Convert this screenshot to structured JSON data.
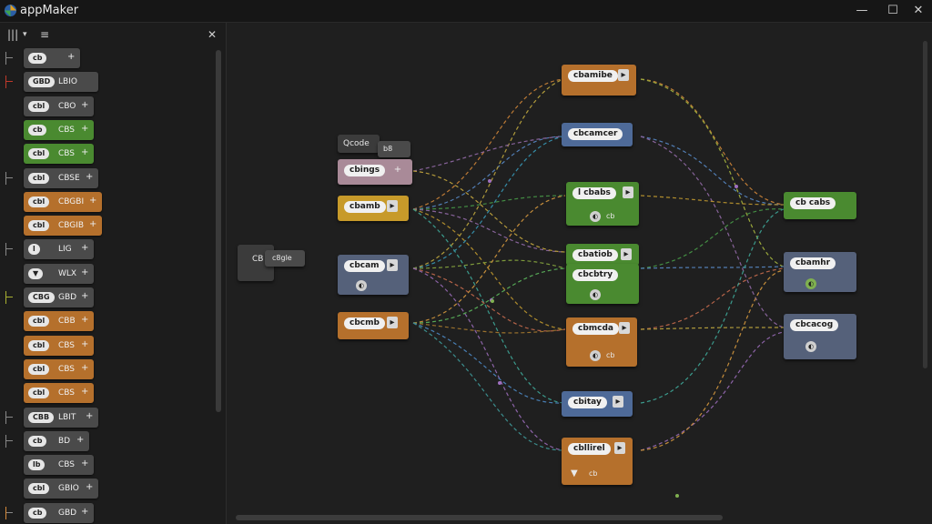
{
  "app": {
    "title": "appMaker"
  },
  "window": {
    "minimize": "—",
    "maximize": "☐",
    "close": "✕"
  },
  "toolbar": {
    "columns_icon": "|||",
    "dropdown": "▾",
    "menu_icon": "≡",
    "close_icon": "✕"
  },
  "palette": [
    {
      "chip": "cb",
      "text": "",
      "plus": "+",
      "color": "#4a4a4a",
      "bracket": "gray"
    },
    {
      "chip": "GBD",
      "text": "LBIO",
      "plus": "",
      "color": "#4a4a4a",
      "bracket": "red"
    },
    {
      "chip": "cbl",
      "text": "CBO",
      "plus": "+",
      "color": "#4a4a4a",
      "bracket": "none"
    },
    {
      "chip": "cb",
      "text": "CBS",
      "plus": "+",
      "color": "#4a8a30",
      "bracket": "none"
    },
    {
      "chip": "cbl",
      "text": "CBS",
      "plus": "+",
      "color": "#4a8a30",
      "bracket": "none"
    },
    {
      "chip": "cbl",
      "text": "CBSE",
      "plus": "+",
      "color": "#4a4a4a",
      "bracket": "gray"
    },
    {
      "chip": "cbl",
      "text": "CBGBI",
      "plus": "+",
      "color": "#b5702c",
      "bracket": "none"
    },
    {
      "chip": "cbl",
      "text": "CBGIB",
      "plus": "+",
      "color": "#b5702c",
      "bracket": "none"
    },
    {
      "chip": "l",
      "text": "LIG",
      "plus": "+",
      "color": "#4a4a4a",
      "bracket": "gray"
    },
    {
      "chip": "▼",
      "text": "WLX",
      "plus": "+",
      "color": "#4a4a4a",
      "bracket": "none"
    },
    {
      "chip": "CBG",
      "text": "GBD",
      "plus": "+",
      "color": "#4a4a4a",
      "bracket": "lime"
    },
    {
      "chip": "cbl",
      "text": "CBB",
      "plus": "+",
      "color": "#b5702c",
      "bracket": "none"
    },
    {
      "chip": "cbl",
      "text": "CBS",
      "plus": "+",
      "color": "#b5702c",
      "bracket": "none"
    },
    {
      "chip": "cbl",
      "text": "CBS",
      "plus": "+",
      "color": "#b5702c",
      "bracket": "none"
    },
    {
      "chip": "cbl",
      "text": "CBS",
      "plus": "+",
      "color": "#b5702c",
      "bracket": "none"
    },
    {
      "chip": "CBB",
      "text": "LBIT",
      "plus": "+",
      "color": "#4a4a4a",
      "bracket": "gray"
    },
    {
      "chip": "cb",
      "text": "BD",
      "plus": "+",
      "color": "#4a4a4a",
      "bracket": "gray"
    },
    {
      "chip": "lb",
      "text": "CBS",
      "plus": "+",
      "color": "#4a4a4a",
      "bracket": "none"
    },
    {
      "chip": "cbl",
      "text": "GBIO",
      "plus": "+",
      "color": "#4a4a4a",
      "bracket": "none"
    },
    {
      "chip": "cb",
      "text": "GBD",
      "plus": "+",
      "color": "#4a4a4a",
      "bracket": "orange"
    }
  ],
  "nodes": {
    "start_label": "CB",
    "start_pill": "c8gle",
    "header_tag": "Qcode",
    "header_tag2": "b8",
    "pink_node": "cbings",
    "yellow_node": "cbamb",
    "slate_node": "cbcam",
    "orange_mid": "cbcmb",
    "top_orange": "cbamibe",
    "top_blue": "cbcamcer",
    "mid_green1": "l cbabs",
    "mid_green1_sub": "cb",
    "mid_green2": "cbatiob",
    "mid_green3": "cbcbtry",
    "mid_orange": "cbmcda",
    "mid_orange_sub": "cb",
    "low_blue": "cbitay",
    "bottom_orange": "cbllirel",
    "bottom_orange_sub": "cb",
    "right_green": "cb cabs",
    "right_slate1": "cbamhr",
    "right_slate2": "cbcacog",
    "sub_glyph": "◐"
  }
}
